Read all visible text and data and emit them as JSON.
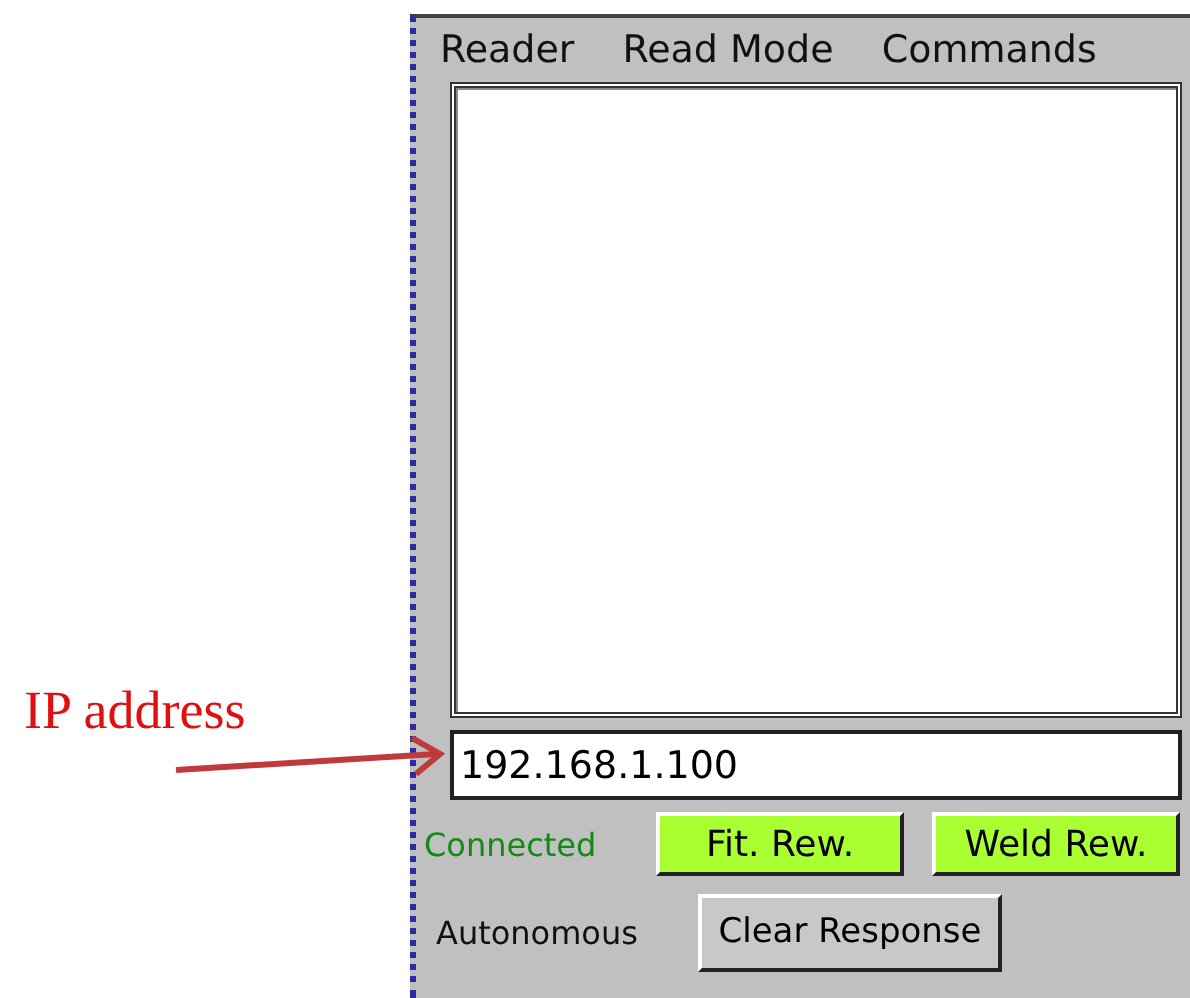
{
  "annotation": {
    "label": "IP address"
  },
  "menu": [
    "Reader",
    "Read Mode",
    "Commands"
  ],
  "ip_field": {
    "value": "192.168.1.100"
  },
  "status": {
    "text": "Connected",
    "connected": true
  },
  "reward_buttons": [
    "Fit. Rew.",
    "Weld Rew."
  ],
  "mode": "Autonomous",
  "clear_button": "Clear Response"
}
